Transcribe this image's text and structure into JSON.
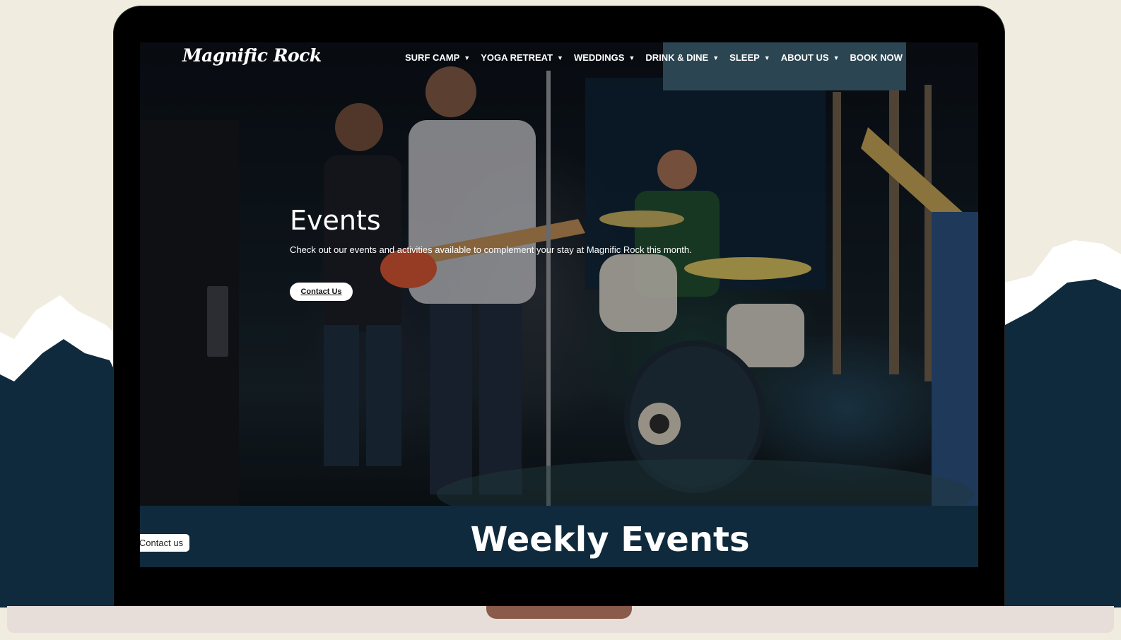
{
  "site": {
    "logo": "Magnific Rock"
  },
  "nav": [
    {
      "label": "SURF CAMP",
      "dropdown": true
    },
    {
      "label": "YOGA RETREAT",
      "dropdown": true
    },
    {
      "label": "WEDDINGS",
      "dropdown": true
    },
    {
      "label": "DRINK & DINE",
      "dropdown": true
    },
    {
      "label": "SLEEP",
      "dropdown": true
    },
    {
      "label": "ABOUT US",
      "dropdown": true
    },
    {
      "label": "BOOK NOW",
      "dropdown": false
    }
  ],
  "hero": {
    "title": "Events",
    "description": "Check out our events and activities available to complement your stay at Magnific Rock this month.",
    "button_label": "Contact Us"
  },
  "section": {
    "title": "Weekly Events",
    "floating_button": "Contact us"
  },
  "colors": {
    "page_bg": "#f0ede0",
    "mountain_dark": "#0f2a3d",
    "snow": "#ffffff",
    "band": "#0f2a3d",
    "base": "#e7deda",
    "notch": "#8a5a4a"
  },
  "icons": {
    "chevron": "chevron-down-icon"
  }
}
